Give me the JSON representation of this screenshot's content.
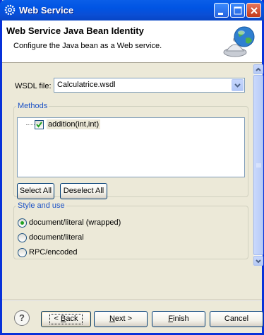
{
  "window": {
    "title": "Web Service",
    "title_icon": "eclipse-gear-icon",
    "controls": {
      "minimize": "minimize-icon",
      "maximize": "maximize-icon",
      "close": "close-icon"
    }
  },
  "header": {
    "title": "Web Service Java Bean Identity",
    "description": "Configure the Java bean as a Web service.",
    "icon": "globe-bell-icon"
  },
  "wsdl": {
    "label": "WSDL file:",
    "value": "Calculatrice.wsdl"
  },
  "methods": {
    "legend": "Methods",
    "items": [
      {
        "label": "addition(int,int)",
        "checked": true
      }
    ],
    "select_all": "Select All",
    "deselect_all": "Deselect All"
  },
  "style": {
    "legend": "Style and use",
    "options": [
      {
        "label": "document/literal (wrapped)",
        "selected": true
      },
      {
        "label": "document/literal",
        "selected": false
      },
      {
        "label": "RPC/encoded",
        "selected": false
      }
    ]
  },
  "footer": {
    "help": "?",
    "back": {
      "prefix": "< ",
      "mnemonic": "B",
      "rest": "ack"
    },
    "next": {
      "mnemonic": "N",
      "rest": "ext >"
    },
    "finish": {
      "mnemonic": "F",
      "rest": "inish"
    },
    "cancel": "Cancel"
  },
  "colors": {
    "titlebar": "#0054e3",
    "group_legend": "#1c52c6",
    "radio_selected": "#21a121"
  }
}
